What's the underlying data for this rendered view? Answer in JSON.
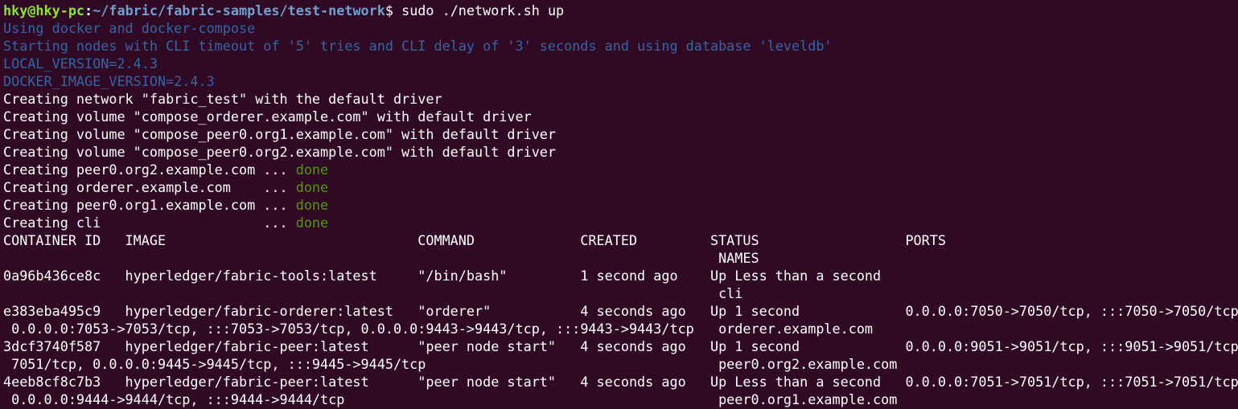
{
  "colors": {
    "background": "#300a24",
    "prompt_user": "#8ae234",
    "prompt_path": "#729fcf",
    "info_text": "#3465a4",
    "done_text": "#4e9a06",
    "default_text": "#ffffff"
  },
  "prompt": {
    "user_host": "hky@hky-pc",
    "separator": ":",
    "path": "~/fabric/fabric-samples/test-network",
    "dollar": "$",
    "command": " sudo ./network.sh up"
  },
  "info_lines": [
    "Using docker and docker-compose",
    "Starting nodes with CLI timeout of '5' tries and CLI delay of '3' seconds and using database 'leveldb'",
    "LOCAL_VERSION=2.4.3",
    "DOCKER_IMAGE_VERSION=2.4.3"
  ],
  "creating_lines": [
    "Creating network \"fabric_test\" with the default driver",
    "Creating volume \"compose_orderer.example.com\" with default driver",
    "Creating volume \"compose_peer0.org1.example.com\" with default driver",
    "Creating volume \"compose_peer0.org2.example.com\" with default driver"
  ],
  "container_lines": [
    {
      "prefix": "Creating peer0.org2.example.com ... ",
      "status": "done"
    },
    {
      "prefix": "Creating orderer.example.com    ... ",
      "status": "done"
    },
    {
      "prefix": "Creating peer0.org1.example.com ... ",
      "status": "done"
    },
    {
      "prefix": "Creating cli                    ... ",
      "status": "done"
    }
  ],
  "table_lines": [
    "CONTAINER ID   IMAGE                               COMMAND             CREATED         STATUS                  PORTS",
    "                                                                                        NAMES",
    "0a96b436ce8c   hyperledger/fabric-tools:latest     \"/bin/bash\"         1 second ago    Up Less than a second",
    "                                                                                        cli",
    "e383eba495c9   hyperledger/fabric-orderer:latest   \"orderer\"           4 seconds ago   Up 1 second             0.0.0.0:7050->7050/tcp, :::7050->7050/tcp,",
    " 0.0.0.0:7053->7053/tcp, :::7053->7053/tcp, 0.0.0.0:9443->9443/tcp, :::9443->9443/tcp   orderer.example.com",
    "3dcf3740f587   hyperledger/fabric-peer:latest      \"peer node start\"   4 seconds ago   Up 1 second             0.0.0.0:9051->9051/tcp, :::9051->9051/tcp,",
    " 7051/tcp, 0.0.0.0:9445->9445/tcp, :::9445->9445/tcp                                    peer0.org2.example.com",
    "4eeb8cf8c7b3   hyperledger/fabric-peer:latest      \"peer node start\"   4 seconds ago   Up Less than a second   0.0.0.0:7051->7051/tcp, :::7051->7051/tcp,",
    " 0.0.0.0:9444->9444/tcp, :::9444->9444/tcp                                              peer0.org1.example.com"
  ]
}
